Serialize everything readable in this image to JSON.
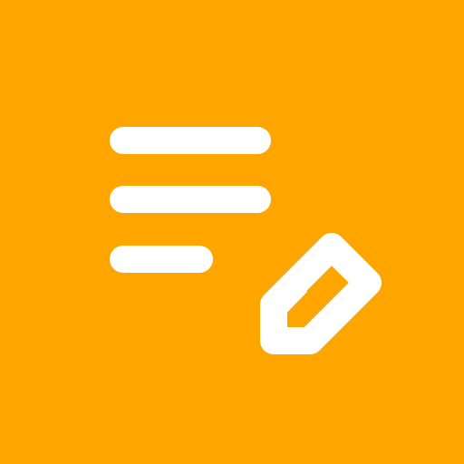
{
  "app_icon": {
    "icon": "edit-note-icon",
    "background_color": "#FFA500",
    "foreground_color": "#FFFFFF"
  }
}
